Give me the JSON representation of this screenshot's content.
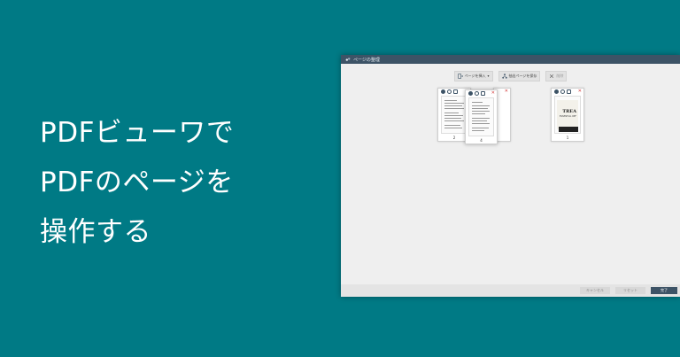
{
  "hero": {
    "line1": "PDFビューワで",
    "line2": "PDFのページを",
    "line3": "操作する"
  },
  "window": {
    "title": "ページの整理",
    "toolbar": {
      "add_label": "ページを挿入",
      "extract_label": "抽出ページを保存",
      "delete_label": "削除"
    },
    "thumbnails": [
      {
        "page": "2"
      },
      {
        "page": "4"
      },
      {
        "page": "1"
      }
    ],
    "cover": {
      "title": "TREA",
      "subtitle": "ESSENTIAL REF"
    },
    "footer": {
      "cancel_label": "キャンセル",
      "reset_label": "リセット",
      "ok_label": "完了"
    }
  },
  "colors": {
    "background": "#007a85",
    "titlebar": "#3d5366",
    "accent": "#3d5366",
    "close": "#d23a3a"
  },
  "icons": [
    "app-icon",
    "add-page-icon",
    "extract-icon",
    "delete-icon",
    "rotate-icon",
    "duplicate-icon",
    "close-icon"
  ]
}
